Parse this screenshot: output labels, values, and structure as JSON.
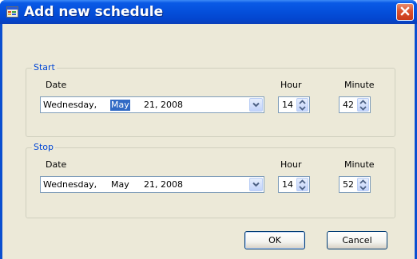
{
  "window": {
    "title": "Add new schedule",
    "icons": {
      "app": "form-icon",
      "close": "close-icon"
    },
    "colors": {
      "titlebar": "#0550dc",
      "close": "#d9512e",
      "groupTitle": "#0046d5",
      "selection": "#316ac5"
    }
  },
  "start": {
    "group_title": "Start",
    "date_label": "Date",
    "hour_label": "Hour",
    "minute_label": "Minute",
    "date": {
      "weekday": "Wednesday,",
      "month": "May",
      "day_year": "21, 2008"
    },
    "hour": "14",
    "minute": "42"
  },
  "stop": {
    "group_title": "Stop",
    "date_label": "Date",
    "hour_label": "Hour",
    "minute_label": "Minute",
    "date": {
      "weekday": "Wednesday,",
      "month": "May",
      "day_year": "21, 2008"
    },
    "hour": "14",
    "minute": "52"
  },
  "buttons": {
    "ok": "OK",
    "cancel": "Cancel"
  }
}
